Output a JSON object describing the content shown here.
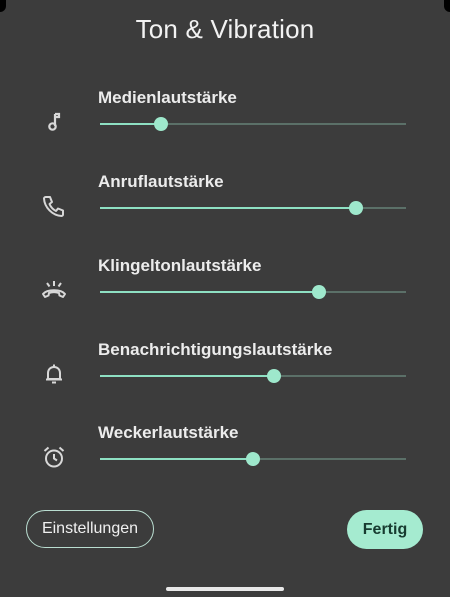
{
  "dialog": {
    "title": "Ton & Vibration"
  },
  "volume_rows": [
    {
      "label": "Medienlautstärke",
      "icon": "music-note-icon",
      "level": 0.2
    },
    {
      "label": "Anruflautstärke",
      "icon": "phone-icon",
      "level": 0.835
    },
    {
      "label": "Klingeltonlautstärke",
      "icon": "ringer-icon",
      "level": 0.715
    },
    {
      "label": "Benachrichtigungslautstärke",
      "icon": "bell-icon",
      "level": 0.57
    },
    {
      "label": "Weckerlautstärke",
      "icon": "alarm-clock-icon",
      "level": 0.5
    }
  ],
  "buttons": {
    "settings_label": "Einstellungen",
    "done_label": "Fertig"
  },
  "colors": {
    "background": "#3c3c3c",
    "accent": "#9ee8cc",
    "track_inactive": "#5b7068",
    "text": "#ececec"
  }
}
